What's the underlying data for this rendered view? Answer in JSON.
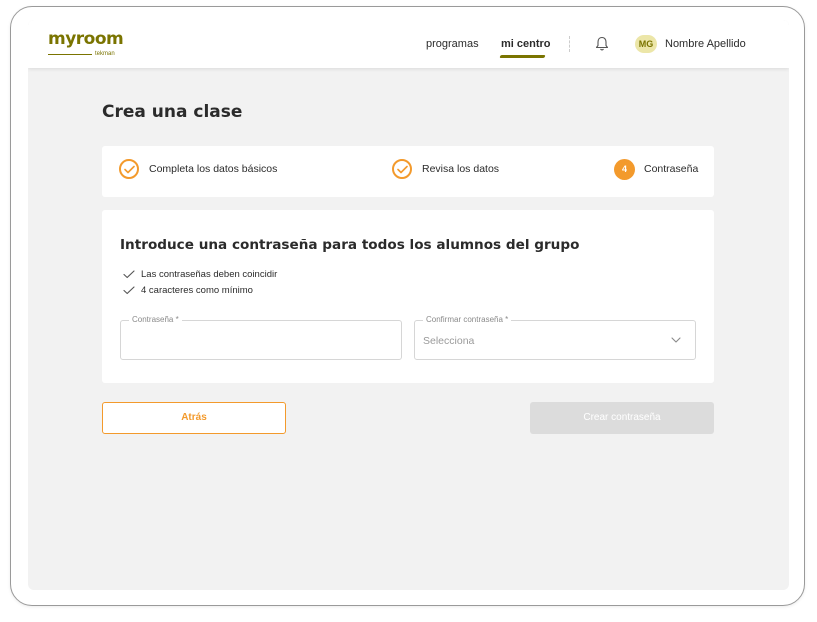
{
  "colors": {
    "brand": "#7a7400",
    "accent": "#f39a2c",
    "background": "#f2f2f2",
    "disabled": "#dcdcdc"
  },
  "header": {
    "logo_text": "myroom",
    "logo_sub": "tekman",
    "nav": [
      {
        "label": "programas",
        "active": false
      },
      {
        "label": "mi centro",
        "active": true
      }
    ],
    "notifications_icon": "bell-icon",
    "user": {
      "initials": "MG",
      "name": "Nombre Apellido"
    }
  },
  "page": {
    "title": "Crea una clase"
  },
  "stepper": {
    "steps": [
      {
        "label": "Completa los datos básicos",
        "status": "done",
        "icon": "check-icon"
      },
      {
        "label": "Revisa los datos",
        "status": "done",
        "icon": "check-icon"
      },
      {
        "label": "Contraseña",
        "status": "current",
        "number": "4"
      }
    ]
  },
  "form": {
    "heading": "Introduce una contraseña para todos los alumnos del grupo",
    "rules": [
      "Las contraseñas deben coincidir",
      "4 caracteres como mínimo"
    ],
    "password": {
      "label": "Contraseña *",
      "value": ""
    },
    "confirm": {
      "label": "Confirmar contraseña *",
      "placeholder": "Selecciona"
    }
  },
  "actions": {
    "back_label": "Atrás",
    "create_label": "Crear contraseña",
    "create_enabled": false
  }
}
